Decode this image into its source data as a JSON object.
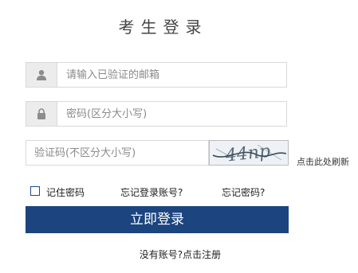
{
  "page": {
    "title": "考生登录"
  },
  "form": {
    "email_placeholder": "请输入已验证的邮箱",
    "password_placeholder": "密码(区分大小写)",
    "captcha_placeholder": "验证码(不区分大小写)",
    "captcha_text": "44np",
    "refresh_label": "点击此处刷新"
  },
  "options": {
    "remember_label": "记住密码",
    "forgot_account": "忘记登录账号?",
    "forgot_password": "忘记密码?"
  },
  "submit_label": "立即登录",
  "register": {
    "prefix": "没有账号?",
    "link": "点击注册"
  },
  "colors": {
    "primary": "#1c447e",
    "input_border": "#d9d9d9",
    "icon_bg": "#ececec"
  },
  "icons": {
    "email": "user-icon",
    "password": "lock-icon"
  }
}
